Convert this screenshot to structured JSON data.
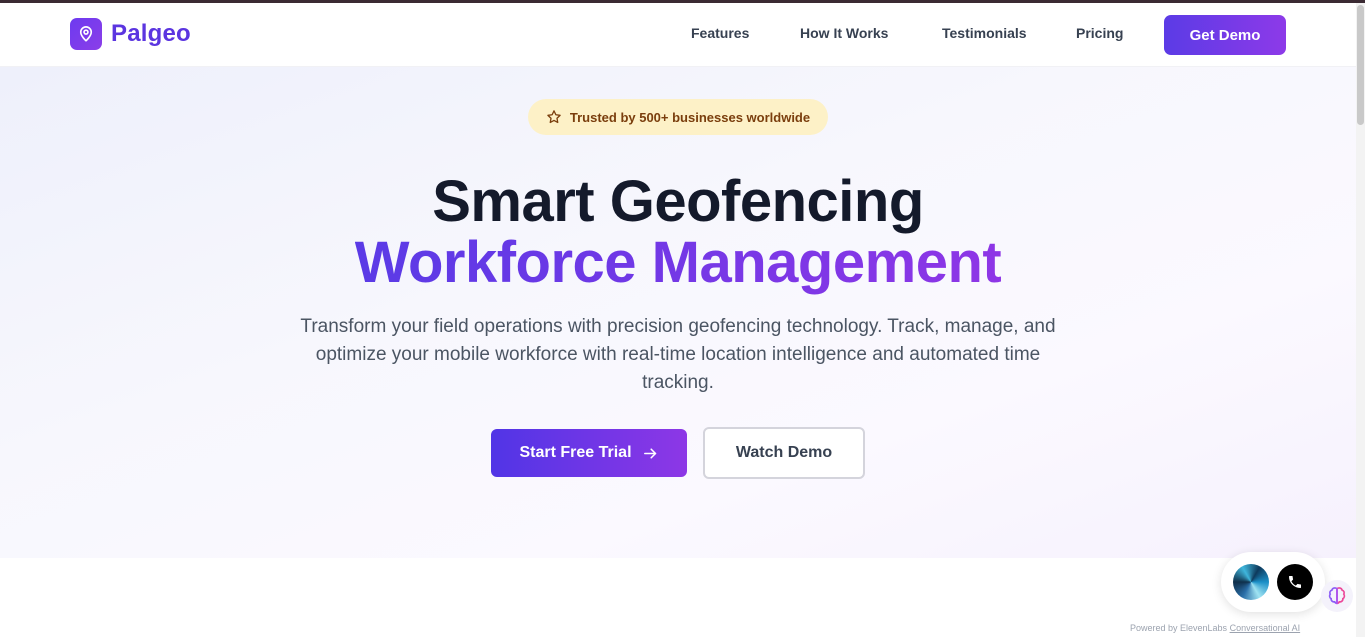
{
  "brand": {
    "name": "Palgeo",
    "logo_icon": "map-pin-icon"
  },
  "nav": {
    "links": [
      "Features",
      "How It Works",
      "Testimonials",
      "Pricing"
    ],
    "cta": "Get Demo"
  },
  "hero": {
    "badge": "Trusted by 500+ businesses worldwide",
    "badge_icon": "star-icon",
    "title_line1": "Smart Geofencing",
    "title_line2": "Workforce Management",
    "subtitle": "Transform your field operations with precision geofencing technology. Track, manage, and optimize your mobile workforce with real-time location intelligence and automated time tracking.",
    "primary_cta": "Start Free Trial",
    "primary_cta_icon": "arrow-right-icon",
    "secondary_cta": "Watch Demo"
  },
  "widget": {
    "powered_prefix": "Powered by ElevenLabs",
    "powered_link": "Conversational AI",
    "call_icon": "phone-icon",
    "brain_icon": "brain-icon"
  },
  "colors": {
    "brand_purple": "#5b35e0",
    "gradient_start": "#5135e6",
    "gradient_end": "#8d37e6",
    "badge_bg": "#fdf1c7",
    "badge_text": "#7a3e0d"
  }
}
